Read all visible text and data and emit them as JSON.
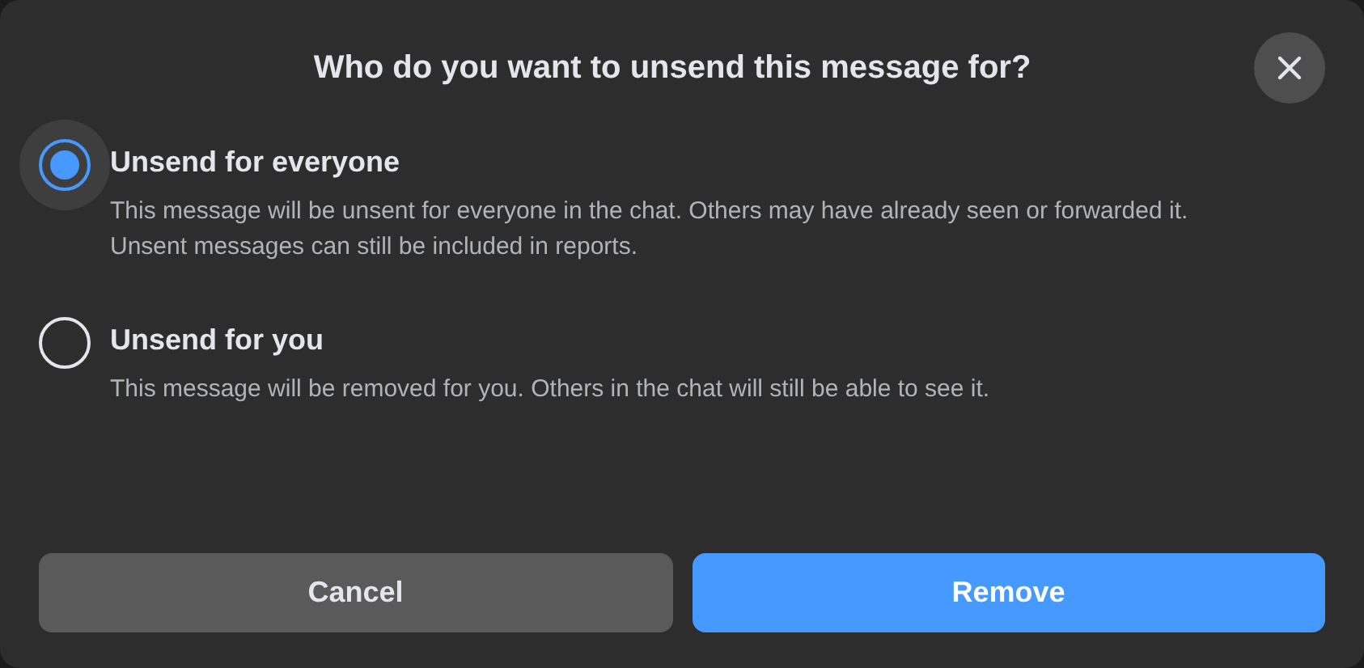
{
  "dialog": {
    "title": "Who do you want to unsend this message for?"
  },
  "options": [
    {
      "label": "Unsend for everyone",
      "description": "This message will be unsent for everyone in the chat. Others may have already seen or forwarded it. Unsent messages can still be included in reports.",
      "selected": true
    },
    {
      "label": "Unsend for you",
      "description": "This message will be removed for you. Others in the chat will still be able to see it.",
      "selected": false
    }
  ],
  "buttons": [
    {
      "label": "Cancel",
      "kind": "secondary"
    },
    {
      "label": "Remove",
      "kind": "primary"
    }
  ]
}
